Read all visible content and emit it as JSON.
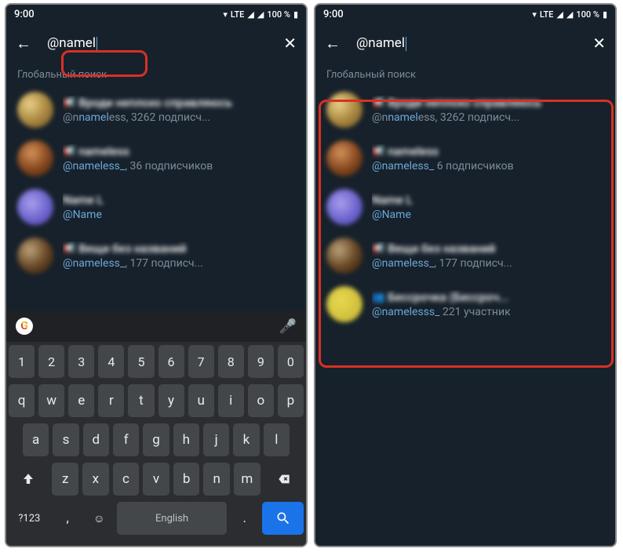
{
  "status": {
    "time": "9:00",
    "network": "LTE",
    "battery": "100 %"
  },
  "search": {
    "query": "@namel"
  },
  "section": {
    "global": "Глобальный поиск"
  },
  "results": [
    {
      "title": "Вроди неплохо справляюсь",
      "handle_pre": "@n",
      "handle_hl": "namel",
      "handle_post": "ess, 3262 подписч...",
      "icon": "megaphone",
      "avatar": "a1"
    },
    {
      "title": "nameless",
      "handle_pre": "",
      "handle_hl": "@nameless_",
      "handle_post": ", 36 подписчиков",
      "icon": "megaphone",
      "avatar": "a2"
    },
    {
      "title": "Name L",
      "handle_pre": "",
      "handle_hl": "@Name",
      "handle_post": "",
      "icon": "",
      "avatar": "a3"
    },
    {
      "title": "Вещи без названий",
      "handle_pre": "",
      "handle_hl": "@nameless_",
      "handle_post": ", 177 подписч...",
      "icon": "megaphone",
      "avatar": "a4"
    }
  ],
  "results_right_extra": [
    {
      "title": "Бессрочка (Бессроч...",
      "handle_pre": "",
      "handle_hl": "@namelesss_",
      "handle_post": "   221 участник",
      "icon": "group",
      "avatar": "a5"
    }
  ],
  "results_right_override": {
    "1": {
      "handle_post": "  6 подписчиков"
    }
  },
  "keyboard": {
    "nums": [
      "1",
      "2",
      "3",
      "4",
      "5",
      "6",
      "7",
      "8",
      "9",
      "0"
    ],
    "row1": [
      "q",
      "w",
      "e",
      "r",
      "t",
      "y",
      "u",
      "i",
      "o",
      "p"
    ],
    "row2": [
      "a",
      "s",
      "d",
      "f",
      "g",
      "h",
      "j",
      "k",
      "l"
    ],
    "row3": [
      "z",
      "x",
      "c",
      "v",
      "b",
      "n",
      "m"
    ],
    "symkey": "?123",
    "comma": ",",
    "lang": "English",
    "period": "."
  }
}
